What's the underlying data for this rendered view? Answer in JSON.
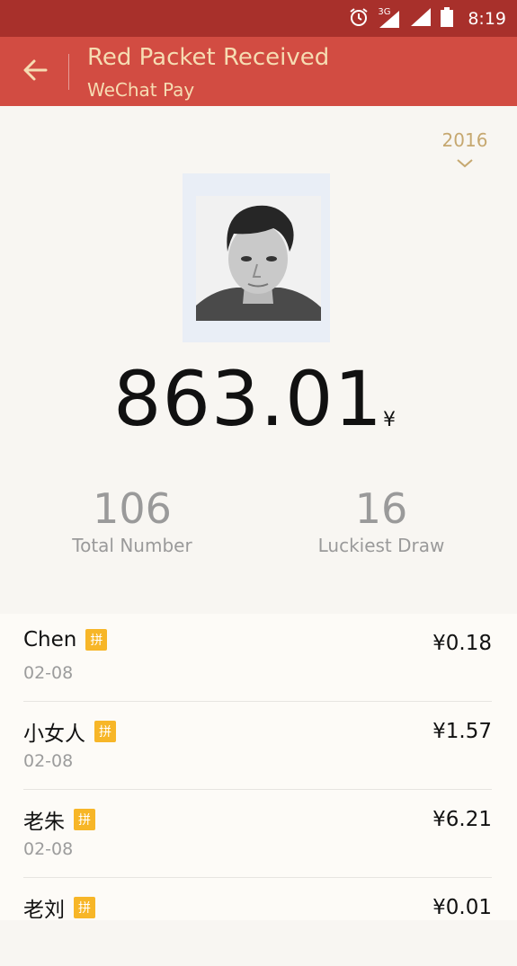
{
  "status_bar": {
    "icons": [
      "alarm-icon",
      "signal-3g-icon",
      "signal-icon",
      "battery-icon"
    ],
    "network_label": "3G",
    "time": "8:19"
  },
  "header": {
    "title": "Red Packet Received",
    "subtitle": "WeChat Pay",
    "back_icon": "back-arrow-icon"
  },
  "year_selector": {
    "value": "2016",
    "icon": "chevron-down-icon"
  },
  "summary": {
    "amount": "863.01",
    "currency_symbol": "¥",
    "total_number": "106",
    "total_number_label": "Total Number",
    "luckiest_draw": "16",
    "luckiest_draw_label": "Luckiest Draw"
  },
  "list": [
    {
      "name": "Chen",
      "badge": "拼",
      "date": "02-08",
      "amount": "¥0.18"
    },
    {
      "name": "小女人",
      "badge": "拼",
      "date": "02-08",
      "amount": "¥1.57"
    },
    {
      "name": "老朱",
      "badge": "拼",
      "date": "02-08",
      "amount": "¥6.21"
    },
    {
      "name": "老刘",
      "badge": "拼",
      "date": "",
      "amount": "¥0.01"
    }
  ],
  "colors": {
    "status_bar": "#a8302b",
    "app_bar": "#d24c42",
    "header_text": "#f6dcb2",
    "year_text": "#c6a870",
    "badge": "#f7b628",
    "background": "#f8f6f2"
  }
}
